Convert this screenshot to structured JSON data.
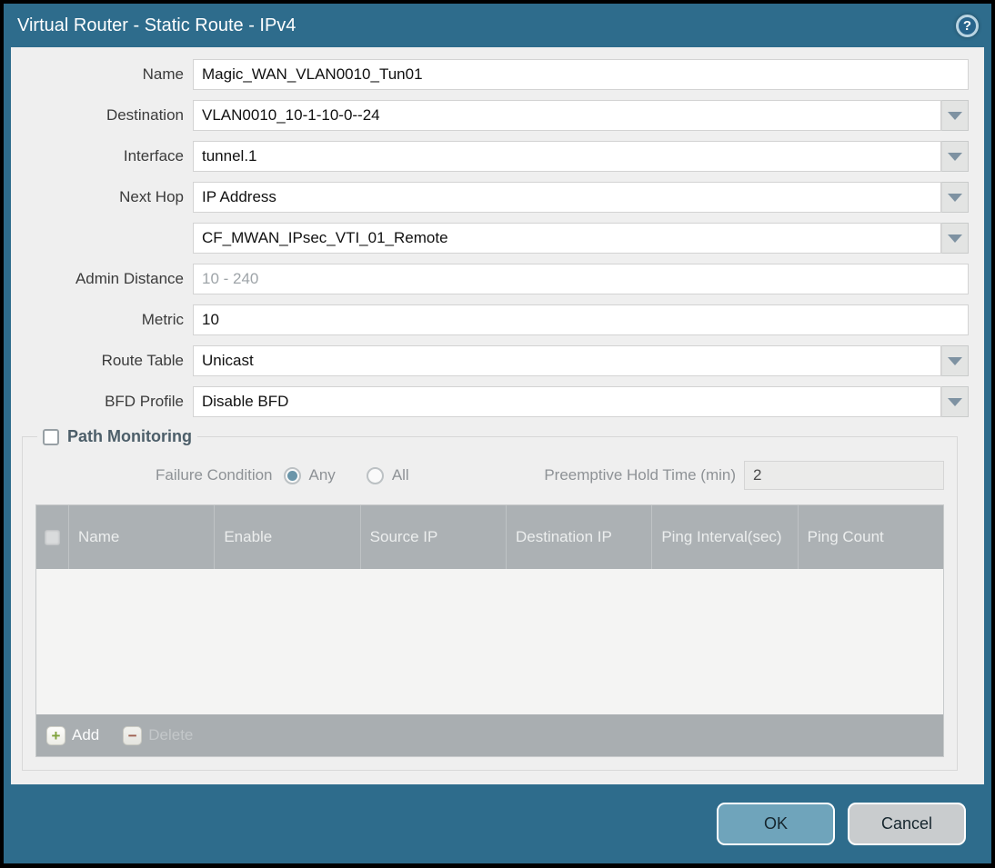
{
  "title_bar": {
    "title": "Virtual Router - Static Route - IPv4",
    "help_icon": "?"
  },
  "form": {
    "name": {
      "label": "Name",
      "value": "Magic_WAN_VLAN0010_Tun01"
    },
    "destination": {
      "label": "Destination",
      "value": "VLAN0010_10-1-10-0--24"
    },
    "interface": {
      "label": "Interface",
      "value": "tunnel.1"
    },
    "next_hop": {
      "label": "Next Hop",
      "value": "IP Address"
    },
    "next_hop_address": {
      "label": "",
      "value": "CF_MWAN_IPsec_VTI_01_Remote"
    },
    "admin_distance": {
      "label": "Admin Distance",
      "placeholder": "10 - 240",
      "value": ""
    },
    "metric": {
      "label": "Metric",
      "value": "10"
    },
    "route_table": {
      "label": "Route Table",
      "value": "Unicast"
    },
    "bfd_profile": {
      "label": "BFD Profile",
      "value": "Disable BFD"
    }
  },
  "path_monitoring": {
    "title": "Path Monitoring",
    "checked": false,
    "failure_condition": {
      "label": "Failure Condition",
      "options": [
        {
          "label": "Any",
          "selected": true
        },
        {
          "label": "All",
          "selected": false
        }
      ]
    },
    "preemptive_hold_time": {
      "label": "Preemptive Hold Time (min)",
      "value": "2"
    },
    "table": {
      "columns": [
        "",
        "Name",
        "Enable",
        "Source IP",
        "Destination IP",
        "Ping Interval(sec)",
        "Ping Count"
      ],
      "rows": []
    },
    "actions": {
      "add": "Add",
      "delete": "Delete"
    }
  },
  "footer": {
    "ok": "OK",
    "cancel": "Cancel"
  },
  "colors": {
    "titlebar": "#2E6C8C",
    "content_bg": "#EFEFEF",
    "table_header": "#ACB1B4",
    "table_footer": "#A9AEB1",
    "ok_button": "#6FA4BB",
    "cancel_button": "#C9CCCE",
    "add_plus": "#7FA23B",
    "delete_minus": "#9E6050",
    "radio_selected": "#6A95A9",
    "dropdown_arrow": "#7E92A2"
  }
}
